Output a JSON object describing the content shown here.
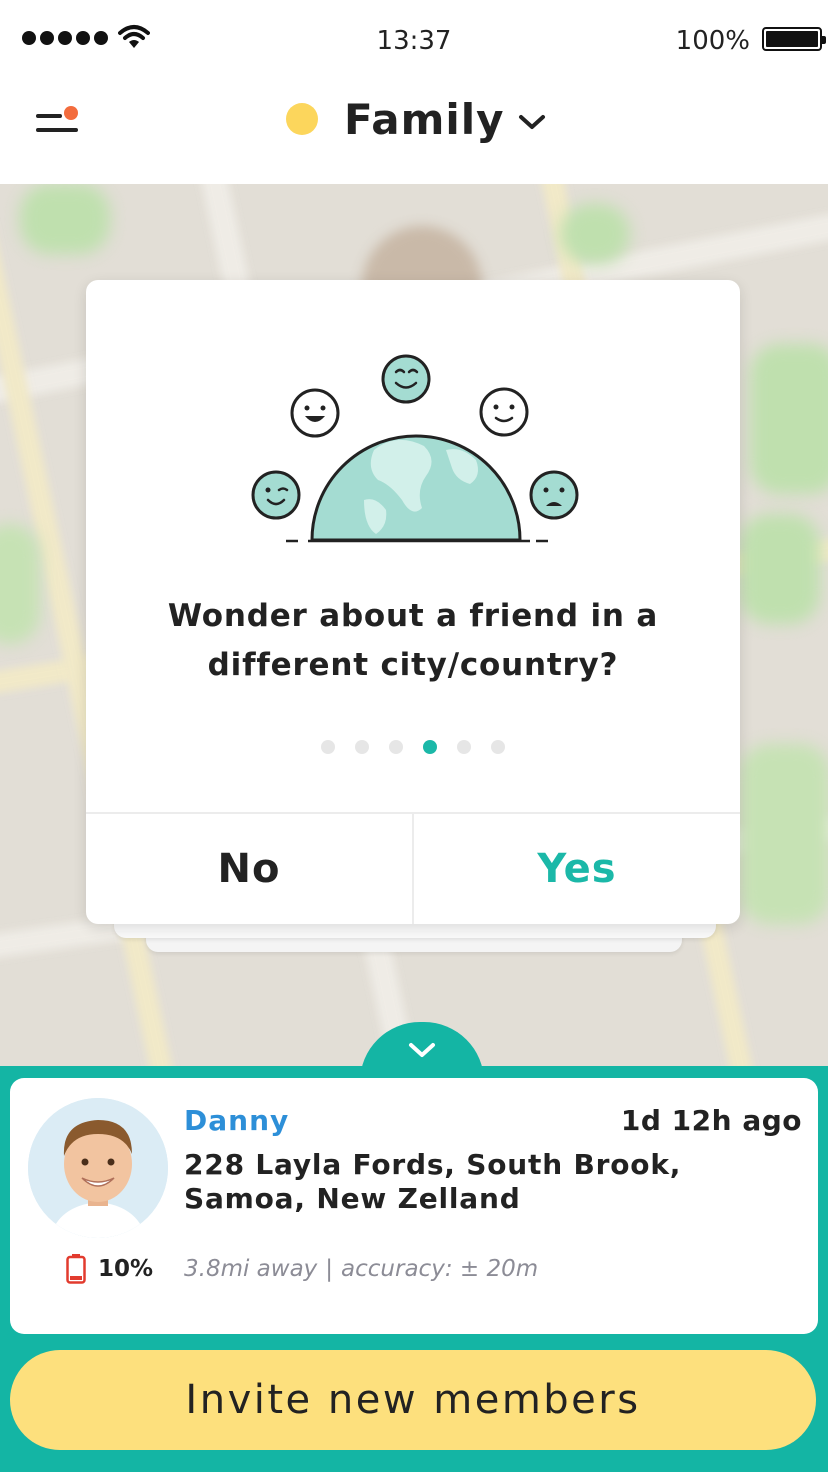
{
  "status_bar": {
    "time": "13:37",
    "battery_percent": "100%",
    "signal_bars": 5,
    "icons": [
      "signal-dots-icon",
      "wifi-icon",
      "battery-icon"
    ]
  },
  "header": {
    "menu_icon": "menu-icon",
    "notification_dot_color": "#f36c3d",
    "group_color": "#fcd65c",
    "group_name": "Family",
    "dropdown_icon": "chevron-down-icon"
  },
  "onboarding_card": {
    "illustration": "globe-with-faces-illustration",
    "question": "Wonder about a friend in a different city/country?",
    "page_count": 6,
    "active_page": 4,
    "no_label": "No",
    "yes_label": "Yes",
    "accent_color": "#1bb8a8"
  },
  "member": {
    "name": "Danny",
    "last_seen": "1d 12h ago",
    "address": "228 Layla Fords, South Brook, Samoa, New Zelland",
    "battery": "10%",
    "distance": "3.8mi away",
    "separator": "|",
    "accuracy": "accuracy: ± 20m",
    "name_color": "#2d8fd8"
  },
  "bottom": {
    "collapse_icon": "chevron-down-icon",
    "invite_label": "Invite new members",
    "panel_color": "#14b5a4",
    "invite_color": "#fde07d"
  }
}
